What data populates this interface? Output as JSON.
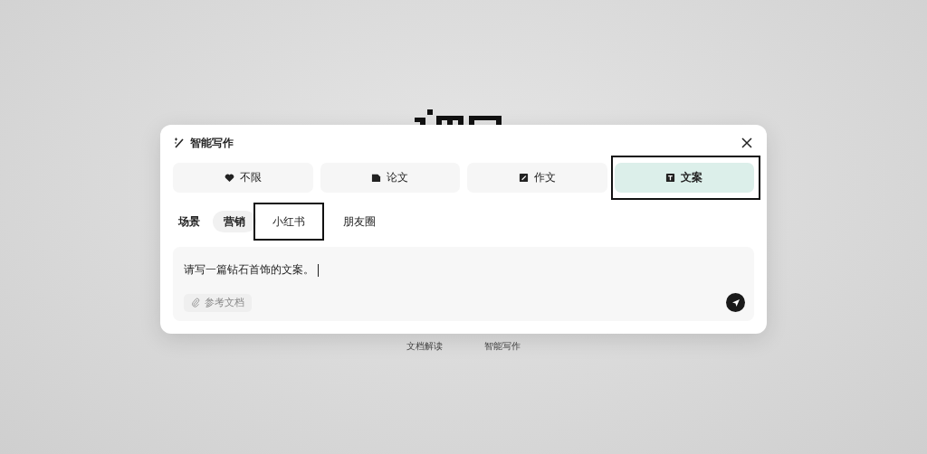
{
  "dialog": {
    "title": "智能写作"
  },
  "tabs": [
    {
      "label": "不限",
      "selected": false,
      "highlighted": false
    },
    {
      "label": "论文",
      "selected": false,
      "highlighted": false
    },
    {
      "label": "作文",
      "selected": false,
      "highlighted": false
    },
    {
      "label": "文案",
      "selected": true,
      "highlighted": true
    }
  ],
  "scene": {
    "label": "场景",
    "options": [
      {
        "label": "营销",
        "selected": true,
        "highlighted": false
      },
      {
        "label": "小红书",
        "selected": false,
        "highlighted": true
      },
      {
        "label": "朋友圈",
        "selected": false,
        "highlighted": false
      }
    ]
  },
  "prompt": {
    "value": "请写一篇钻石首饰的文案。",
    "attach_label": "参考文档"
  },
  "footer_links": [
    "文档解读",
    "智能写作"
  ]
}
